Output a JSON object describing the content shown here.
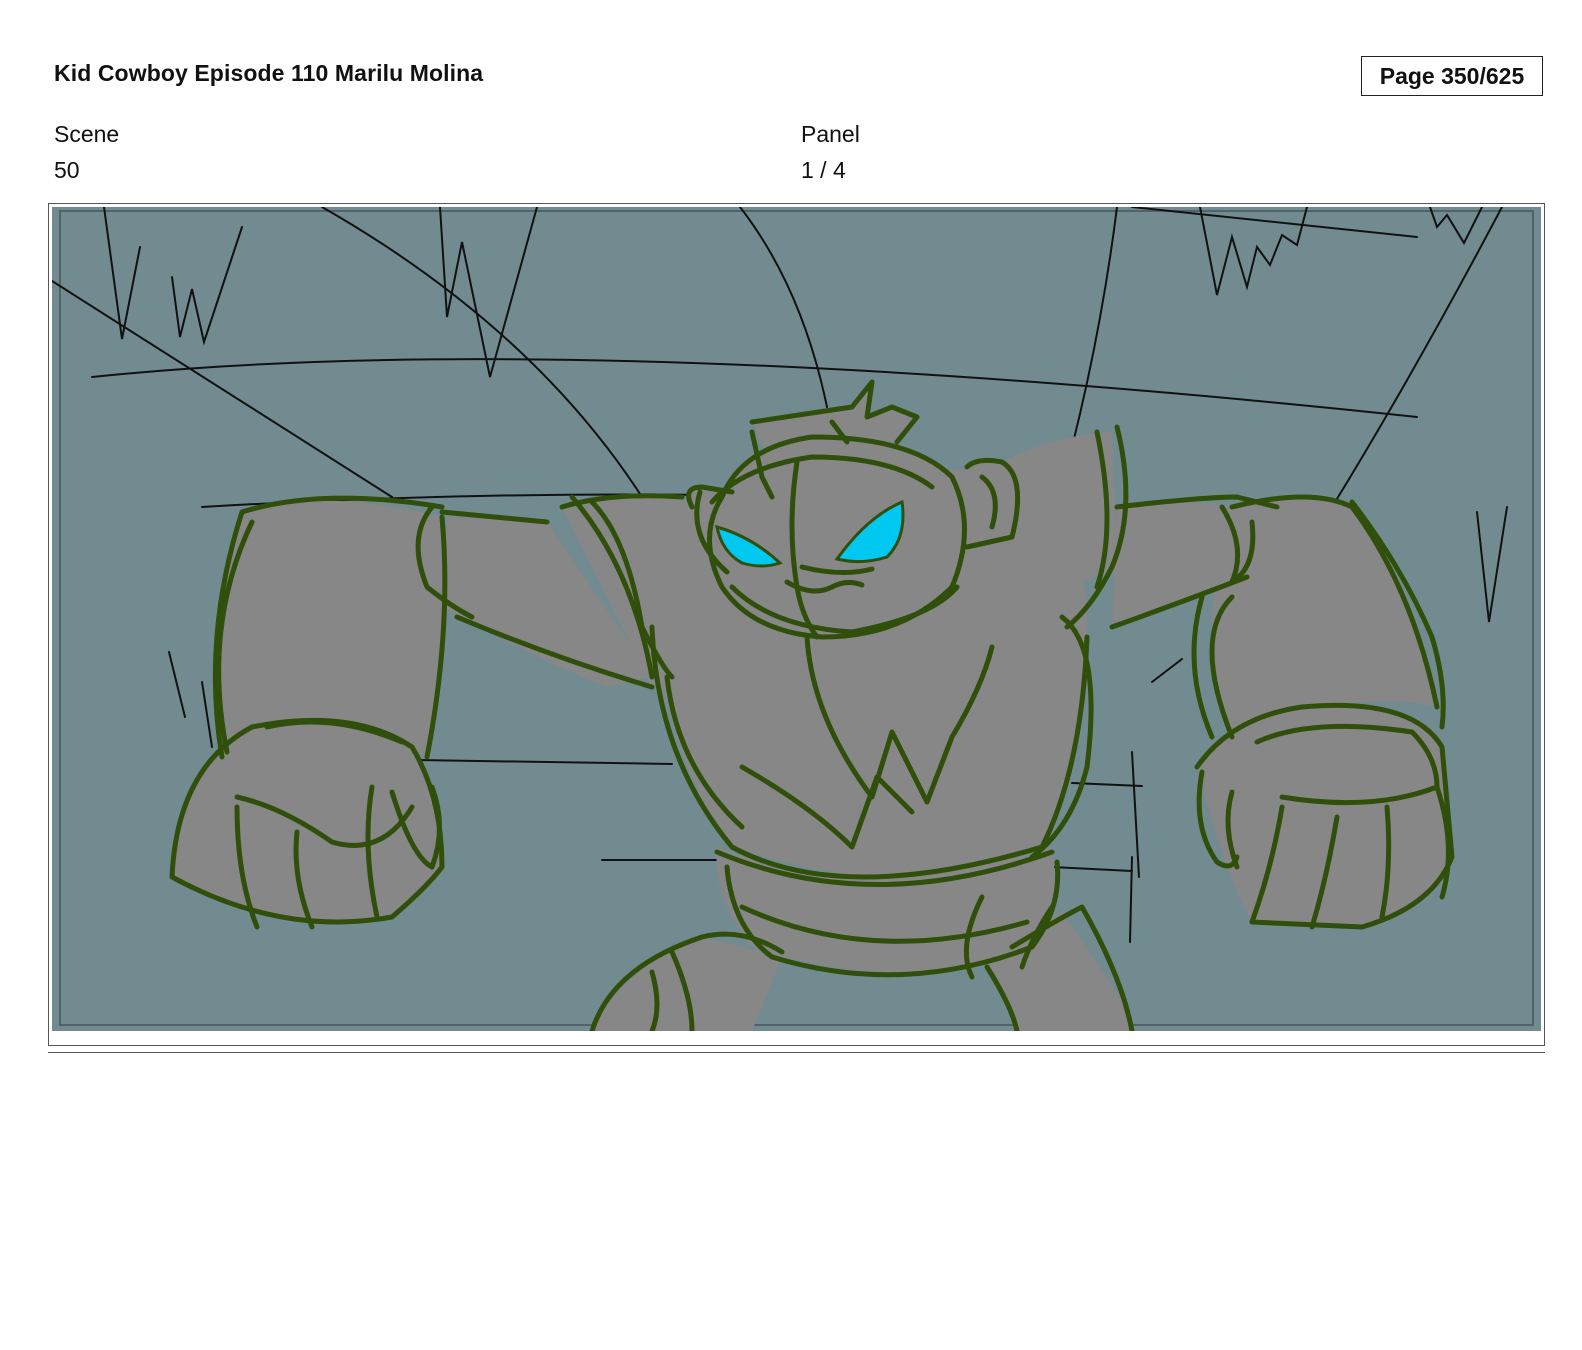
{
  "header": {
    "title": "Kid Cowboy Episode 110 Marilu Molina",
    "page_counter": "Page 350/625"
  },
  "scene": {
    "label": "Scene",
    "value": "50"
  },
  "panel": {
    "label": "Panel",
    "value": "1 / 4"
  },
  "artwork": {
    "colors": {
      "background": "#728b91",
      "body_fill": "#878787",
      "outline": "#2f4f0a",
      "eyes": "#00c8f0",
      "sketch_lines": "#111111"
    }
  }
}
